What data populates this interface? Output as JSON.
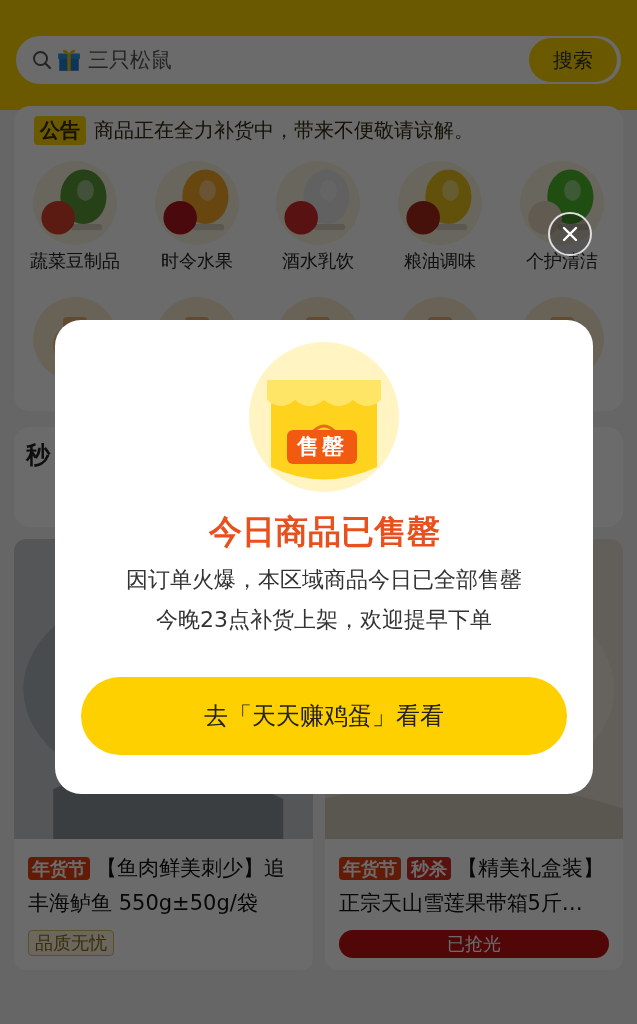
{
  "search": {
    "placeholder": "三只松鼠",
    "button": "搜索"
  },
  "notice": {
    "badge": "公告",
    "text": "商品正在全力补货中，带来不便敬请谅解。"
  },
  "categories": [
    {
      "label": "蔬菜豆制品"
    },
    {
      "label": "时令水果"
    },
    {
      "label": "酒水乳饮"
    },
    {
      "label": "粮油调味"
    },
    {
      "label": "个护清洁"
    }
  ],
  "section": {
    "title": "秒"
  },
  "products": [
    {
      "tags": [
        {
          "label": "年货节",
          "kind": "festival"
        }
      ],
      "title": "【鱼肉鲜美刺少】追丰海鲈鱼 550g±50g/袋",
      "badge": "品质无忧"
    },
    {
      "tags": [
        {
          "label": "年货节",
          "kind": "festival"
        },
        {
          "label": "秒杀",
          "kind": "flash"
        }
      ],
      "title": "【精美礼盒装】正宗天山雪莲果带箱5斤…",
      "status": "已抢光"
    }
  ],
  "dialog": {
    "stamp": "售罄",
    "title": "今日商品已售罄",
    "lines": [
      "因订单火爆，本区域商品今日已全部售罄",
      "今晚23点补货上架，欢迎提早下单"
    ],
    "button": "去「天天赚鸡蛋」看看"
  }
}
